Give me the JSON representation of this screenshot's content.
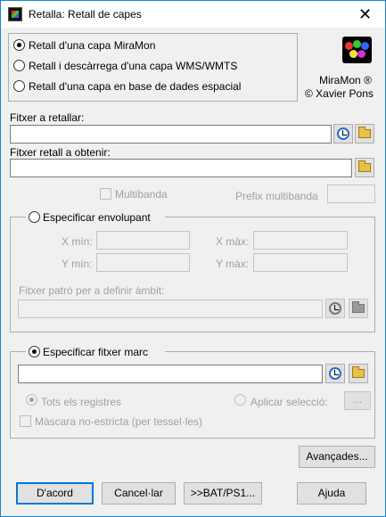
{
  "window": {
    "title": "Retalla: Retall de capes",
    "close_glyph": "✕"
  },
  "mode": {
    "options": [
      "Retall d'una capa MiraMon",
      "Retall i descàrrega d'una capa WMS/WMTS",
      "Retall d'una capa en base de dades espacial"
    ],
    "selected_index": 0
  },
  "about": {
    "product": "MiraMon ®",
    "author": "© Xavier Pons"
  },
  "input_file": {
    "label": "Fitxer a retallar:",
    "value": ""
  },
  "output_file": {
    "label": "Fitxer retall a obtenir:",
    "value": ""
  },
  "multiband": {
    "label": "Multibanda",
    "checked": false,
    "enabled": false
  },
  "multiband_prefix": {
    "label": "Prefix multibanda",
    "value": ""
  },
  "envelope": {
    "label": "Especificar envolupant",
    "selected": false,
    "xmin_label": "X mín:",
    "xmax_label": "X màx:",
    "ymin_label": "Y mín:",
    "ymax_label": "Y màx:",
    "pattern_label": "Fitxer patró per a definir àmbit:"
  },
  "frame": {
    "label": "Especificar fitxer marc",
    "selected": true,
    "value": "",
    "all_records_label": "Tots els registres",
    "apply_selection_label": "Aplicar selecció:",
    "ellipsis_label": "...",
    "non_strict_mask_label": "Màscara no-estricta (per tessel·les)"
  },
  "buttons": {
    "advanced": "Avançades...",
    "ok": "D'acord",
    "cancel": "Cancel·lar",
    "batch": ">>BAT/PS1...",
    "help": "Ajuda"
  },
  "icons": {
    "app": "miramon-app-icon",
    "history": "clock-history-icon",
    "browse": "folder-open-icon"
  }
}
